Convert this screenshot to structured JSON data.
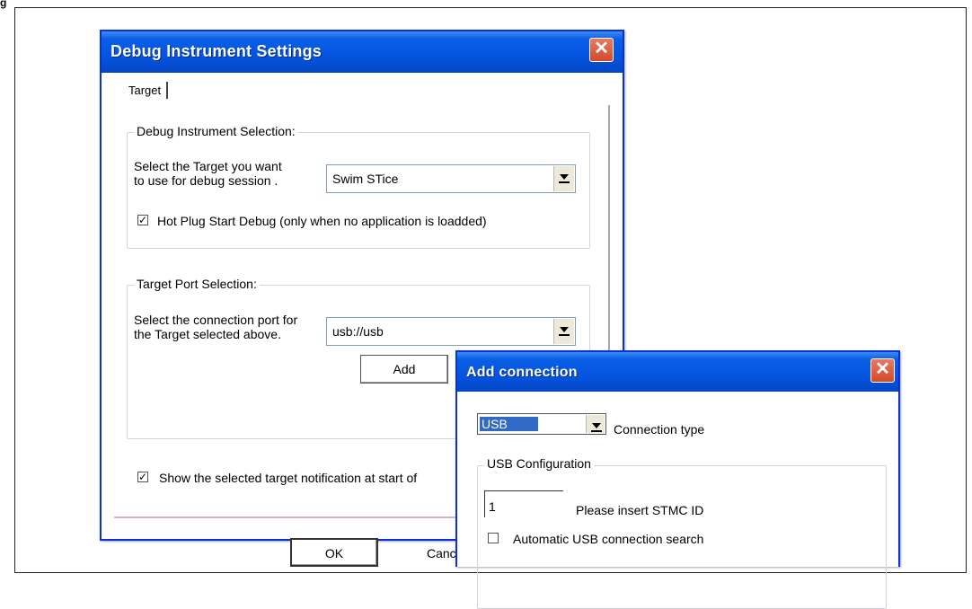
{
  "figure": {
    "label": "g"
  },
  "debug_dialog": {
    "title": "Debug Instrument Settings",
    "close_glyph": "✕",
    "tab": "Target",
    "instrument_group": {
      "legend": "Debug Instrument Selection:",
      "prompt_line1": "Select the Target you want",
      "prompt_line2": "to use for debug session .",
      "selected": "Swim STice",
      "hot_plug_label": "Hot Plug Start Debug (only when no application is loadded)",
      "hot_plug_checked": true
    },
    "port_group": {
      "legend": "Target Port Selection:",
      "prompt_line1": "Select the connection port for",
      "prompt_line2": "the Target selected above.",
      "selected": "usb://usb",
      "add_label": "Add"
    },
    "notification_label": "Show the selected target notification at start of",
    "notification_checked": true,
    "ok_label": "OK",
    "cancel_label": "Canc"
  },
  "add_connection": {
    "title": "Add connection",
    "close_glyph": "✕",
    "type_value": "USB",
    "type_label": "Connection type",
    "usb_group": {
      "legend": "USB Configuration",
      "stmc_id": "1",
      "stmc_label": "Please insert STMC ID",
      "auto_label": "Automatic USB connection search",
      "auto_checked": false
    }
  }
}
